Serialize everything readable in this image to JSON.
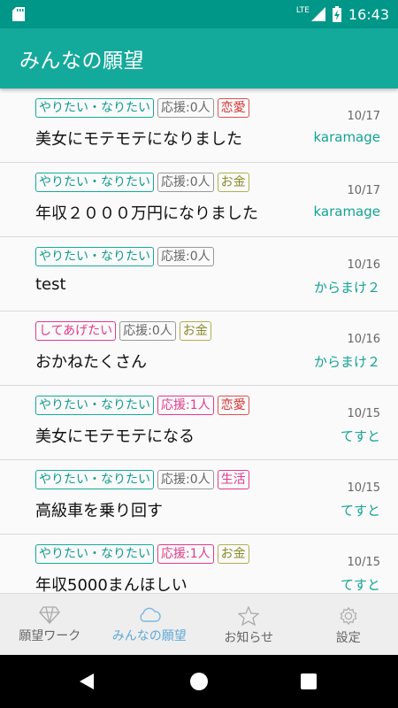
{
  "status_bar": {
    "network": "LTE",
    "time": "16:43"
  },
  "app_bar": {
    "title": "みんなの願望"
  },
  "items": [
    {
      "tags": [
        {
          "text": "やりたい・なりたい",
          "color": "teal"
        },
        {
          "text": "応援:0人",
          "color": "gray"
        },
        {
          "text": "恋愛",
          "color": "red"
        }
      ],
      "date": "10/17",
      "title": "美女にモテモテになりました",
      "author": "karamage"
    },
    {
      "tags": [
        {
          "text": "やりたい・なりたい",
          "color": "teal"
        },
        {
          "text": "応援:0人",
          "color": "gray"
        },
        {
          "text": "お金",
          "color": "olive"
        }
      ],
      "date": "10/17",
      "title": "年収２０００万円になりました",
      "author": "karamage"
    },
    {
      "tags": [
        {
          "text": "やりたい・なりたい",
          "color": "teal"
        },
        {
          "text": "応援:0人",
          "color": "gray"
        }
      ],
      "date": "10/16",
      "title": "test",
      "author": "からまけ２"
    },
    {
      "tags": [
        {
          "text": "してあげたい",
          "color": "pink"
        },
        {
          "text": "応援:0人",
          "color": "gray"
        },
        {
          "text": "お金",
          "color": "olive"
        }
      ],
      "date": "10/16",
      "title": "おかねたくさん",
      "author": "からまけ２"
    },
    {
      "tags": [
        {
          "text": "やりたい・なりたい",
          "color": "teal"
        },
        {
          "text": "応援:1人",
          "color": "pink"
        },
        {
          "text": "恋愛",
          "color": "red"
        }
      ],
      "date": "10/15",
      "title": "美女にモテモテになる",
      "author": "てすと"
    },
    {
      "tags": [
        {
          "text": "やりたい・なりたい",
          "color": "teal"
        },
        {
          "text": "応援:0人",
          "color": "gray"
        },
        {
          "text": "生活",
          "color": "pink"
        }
      ],
      "date": "10/15",
      "title": "高級車を乗り回す",
      "author": "てすと"
    },
    {
      "tags": [
        {
          "text": "やりたい・なりたい",
          "color": "teal"
        },
        {
          "text": "応援:1人",
          "color": "pink"
        },
        {
          "text": "お金",
          "color": "olive"
        }
      ],
      "date": "10/15",
      "title": "年収5000まんほしい",
      "author": "てすと"
    }
  ],
  "bottom_nav": [
    {
      "label": "願望ワーク",
      "icon": "diamond-icon",
      "active": false
    },
    {
      "label": "みんなの願望",
      "icon": "cloud-icon",
      "active": true
    },
    {
      "label": "お知らせ",
      "icon": "star-icon",
      "active": false
    },
    {
      "label": "設定",
      "icon": "gear-icon",
      "active": false
    }
  ],
  "colors": {
    "primary": "#14aa9b",
    "primary_dark": "#009688",
    "active_nav": "#5fa8d6"
  }
}
